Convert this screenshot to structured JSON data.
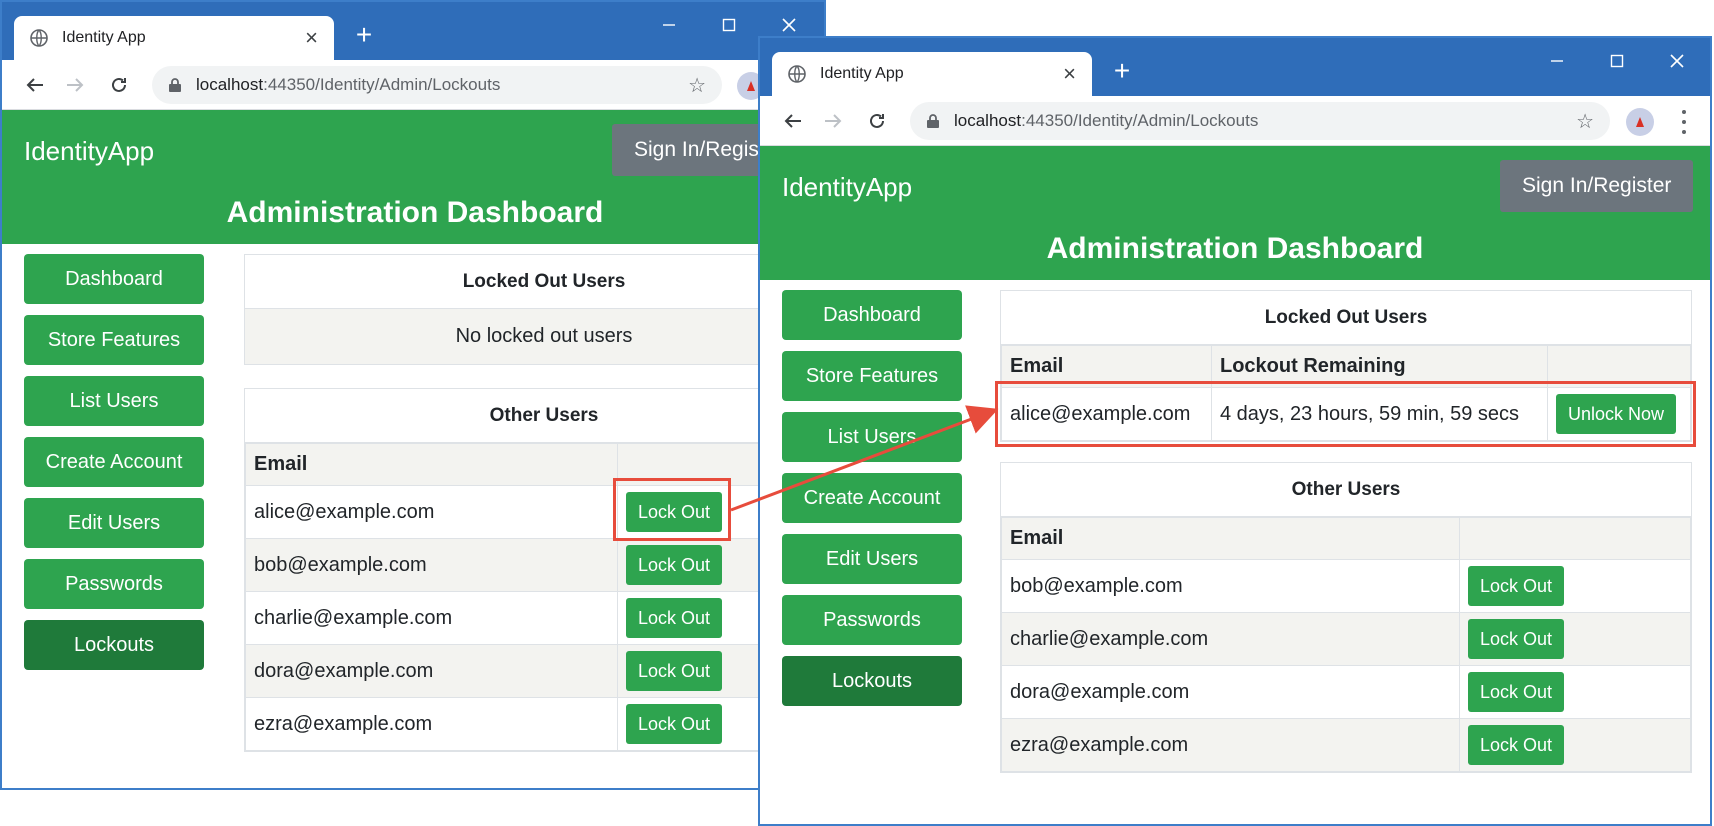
{
  "left_window": {
    "tab_title": "Identity App",
    "url_host": "localhost",
    "url_path": ":44350/Identity/Admin/Lockouts",
    "brand": "IdentityApp",
    "signin_label": "Sign In/Register",
    "dashboard_title": "Administration Dashboard",
    "nav": [
      "Dashboard",
      "Store Features",
      "List Users",
      "Create Account",
      "Edit Users",
      "Passwords",
      "Lockouts"
    ],
    "locked_panel_title": "Locked Out Users",
    "locked_empty_message": "No locked out users",
    "other_panel_title": "Other Users",
    "other_header_email": "Email",
    "other_rows": [
      {
        "email": "alice@example.com",
        "action": "Lock Out"
      },
      {
        "email": "bob@example.com",
        "action": "Lock Out"
      },
      {
        "email": "charlie@example.com",
        "action": "Lock Out"
      },
      {
        "email": "dora@example.com",
        "action": "Lock Out"
      },
      {
        "email": "ezra@example.com",
        "action": "Lock Out"
      }
    ]
  },
  "right_window": {
    "tab_title": "Identity App",
    "url_host": "localhost",
    "url_path": ":44350/Identity/Admin/Lockouts",
    "brand": "IdentityApp",
    "signin_label": "Sign In/Register",
    "dashboard_title": "Administration Dashboard",
    "nav": [
      "Dashboard",
      "Store Features",
      "List Users",
      "Create Account",
      "Edit Users",
      "Passwords",
      "Lockouts"
    ],
    "locked_panel_title": "Locked Out Users",
    "locked_header_email": "Email",
    "locked_header_remaining": "Lockout Remaining",
    "locked_rows": [
      {
        "email": "alice@example.com",
        "remaining": "4 days, 23 hours, 59 min, 59 secs",
        "action": "Unlock Now"
      }
    ],
    "other_panel_title": "Other Users",
    "other_header_email": "Email",
    "other_rows": [
      {
        "email": "bob@example.com",
        "action": "Lock Out"
      },
      {
        "email": "charlie@example.com",
        "action": "Lock Out"
      },
      {
        "email": "dora@example.com",
        "action": "Lock Out"
      },
      {
        "email": "ezra@example.com",
        "action": "Lock Out"
      }
    ]
  },
  "icons": {
    "tab": "globe-icon",
    "close": "close-icon",
    "new_tab": "plus-icon",
    "back": "arrow-left-icon",
    "forward": "arrow-right-icon",
    "reload": "reload-icon",
    "secure": "lock-icon",
    "bookmark": "star-icon",
    "profile": "avatar-icon",
    "menu": "kebab-icon"
  },
  "colors": {
    "titlebar": "#2f6db9",
    "header_green": "#2ea44f",
    "active_nav": "#1f7a3a",
    "signin_gray": "#6c757d",
    "callout_red": "#e74c3c"
  }
}
